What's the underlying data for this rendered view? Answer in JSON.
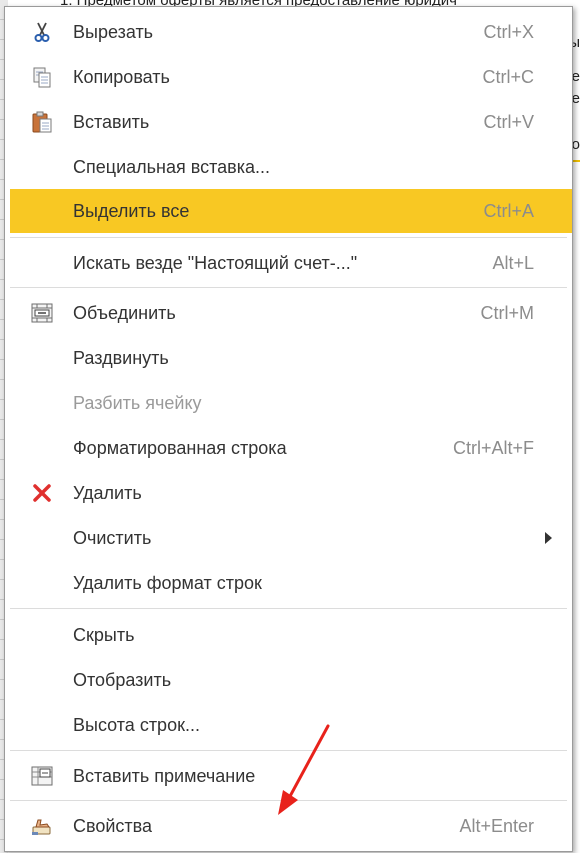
{
  "background": {
    "top_text": "1. Предметом оферты является предоставление юридич",
    "right_chars": [
      "ы",
      "е",
      "е",
      "о"
    ]
  },
  "menu": {
    "items": [
      {
        "label": "Вырезать",
        "shortcut": "Ctrl+X",
        "icon": "scissors-icon"
      },
      {
        "label": "Копировать",
        "shortcut": "Ctrl+C",
        "icon": "copy-icon"
      },
      {
        "label": "Вставить",
        "shortcut": "Ctrl+V",
        "icon": "paste-icon"
      },
      {
        "label": "Специальная вставка...",
        "shortcut": ""
      },
      {
        "label": "Выделить все",
        "shortcut": "Ctrl+A",
        "highlighted": true
      },
      {
        "label": "Искать везде \"Настоящий счет-...\"",
        "shortcut": "Alt+L"
      },
      {
        "label": "Объединить",
        "shortcut": "Ctrl+M",
        "icon": "merge-cells-icon"
      },
      {
        "label": "Раздвинуть",
        "shortcut": ""
      },
      {
        "label": "Разбить ячейку",
        "shortcut": "",
        "disabled": true
      },
      {
        "label": "Форматированная строка",
        "shortcut": "Ctrl+Alt+F"
      },
      {
        "label": "Удалить",
        "shortcut": "",
        "icon": "delete-x-icon"
      },
      {
        "label": "Очистить",
        "shortcut": "",
        "submenu": true
      },
      {
        "label": "Удалить формат строк",
        "shortcut": ""
      },
      {
        "label": "Скрыть",
        "shortcut": ""
      },
      {
        "label": "Отобразить",
        "shortcut": ""
      },
      {
        "label": "Высота строк...",
        "shortcut": ""
      },
      {
        "label": "Вставить примечание",
        "shortcut": "",
        "icon": "note-icon"
      },
      {
        "label": "Свойства",
        "shortcut": "Alt+Enter",
        "icon": "properties-hand-icon"
      }
    ]
  },
  "colors": {
    "highlight": "#f8c823",
    "delete_icon": "#e0302e",
    "annotation_arrow": "#e8221b"
  }
}
